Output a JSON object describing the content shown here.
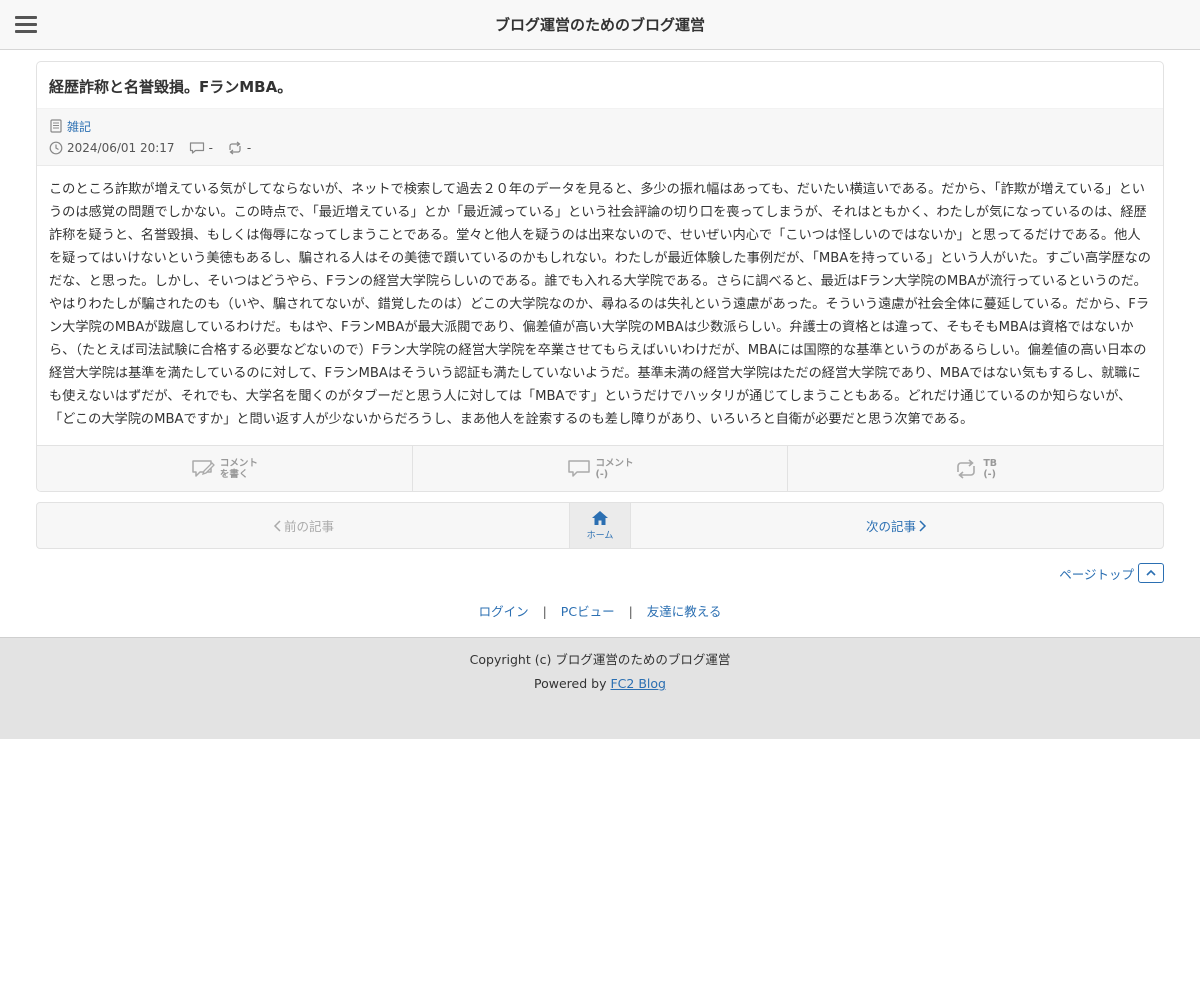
{
  "header": {
    "title": "ブログ運営のためのブログ運営",
    "menu_icon": "hamburger-menu-icon"
  },
  "article": {
    "title": "経歴詐称と名誉毀損。FランMBA。",
    "category": "雑記",
    "date": "2024/06/01 20:17",
    "comment_count": "-",
    "trackback_count": "-",
    "body": "このところ詐欺が増えている気がしてならないが、ネットで検索して過去２０年のデータを見ると、多少の振れ幅はあっても、だいたい横這いである。だから、「詐欺が増えている」というのは感覚の問題でしかない。この時点で、「最近増えている」とか「最近減っている」という社会評論の切り口を喪ってしまうが、それはともかく、わたしが気になっているのは、経歴詐称を疑うと、名誉毀損、もしくは侮辱になってしまうことである。堂々と他人を疑うのは出来ないので、せいぜい内心で「こいつは怪しいのではないか」と思ってるだけである。他人を疑ってはいけないという美徳もあるし、騙される人はその美徳で躓いているのかもしれない。わたしが最近体験した事例だが、「MBAを持っている」という人がいた。すごい高学歴なのだな、と思った。しかし、そいつはどうやら、Fランの経営大学院らしいのである。誰でも入れる大学院である。さらに調べると、最近はFラン大学院のMBAが流行っているというのだ。やはりわたしが騙されたのも（いや、騙されてないが、錯覚したのは）どこの大学院なのか、尋ねるのは失礼という遠慮があった。そういう遠慮が社会全体に蔓延している。だから、Fラン大学院のMBAが跋扈しているわけだ。もはや、FランMBAが最大派閥であり、偏差値が高い大学院のMBAは少数派らしい。弁護士の資格とは違って、そもそもMBAは資格ではないから、（たとえば司法試験に合格する必要などないので）Fラン大学院の経営大学院を卒業させてもらえばいいわけだが、MBAには国際的な基準というのがあるらしい。偏差値の高い日本の経営大学院は基準を満たしているのに対して、FランMBAはそういう認証も満たしていないようだ。基準未満の経営大学院はただの経営大学院であり、MBAではない気もするし、就職にも使えないはずだが、それでも、大学名を聞くのがタブーだと思う人に対しては「MBAです」というだけでハッタリが通じてしまうこともある。どれだけ通じているのか知らないが、「どこの大学院のMBAですか」と問い返す人が少ないからだろうし、まあ他人を詮索するのも差し障りがあり、いろいろと自衛が必要だと思う次第である。"
  },
  "actions": {
    "write_comment_line1": "コメント",
    "write_comment_line2": "を書く",
    "comments_line1": "コメント",
    "comments_line2": "(-)",
    "tb_line1": "TB",
    "tb_line2": "(-)"
  },
  "pager": {
    "prev": "前の記事",
    "home": "ホーム",
    "next": "次の記事"
  },
  "pagetop": "ページトップ",
  "links": {
    "login": "ログイン",
    "pc_view": "PCビュー",
    "tell_friend": "友達に教える",
    "separator": "|"
  },
  "footer": {
    "copyright": "Copyright (c) ブログ運営のためのブログ運営",
    "powered_prefix": "Powered by ",
    "powered_link": "FC2 Blog"
  },
  "colors": {
    "link": "#2b6fb2",
    "header_bg": "#f8f8f8",
    "footer_bg": "#e3e3e3"
  }
}
